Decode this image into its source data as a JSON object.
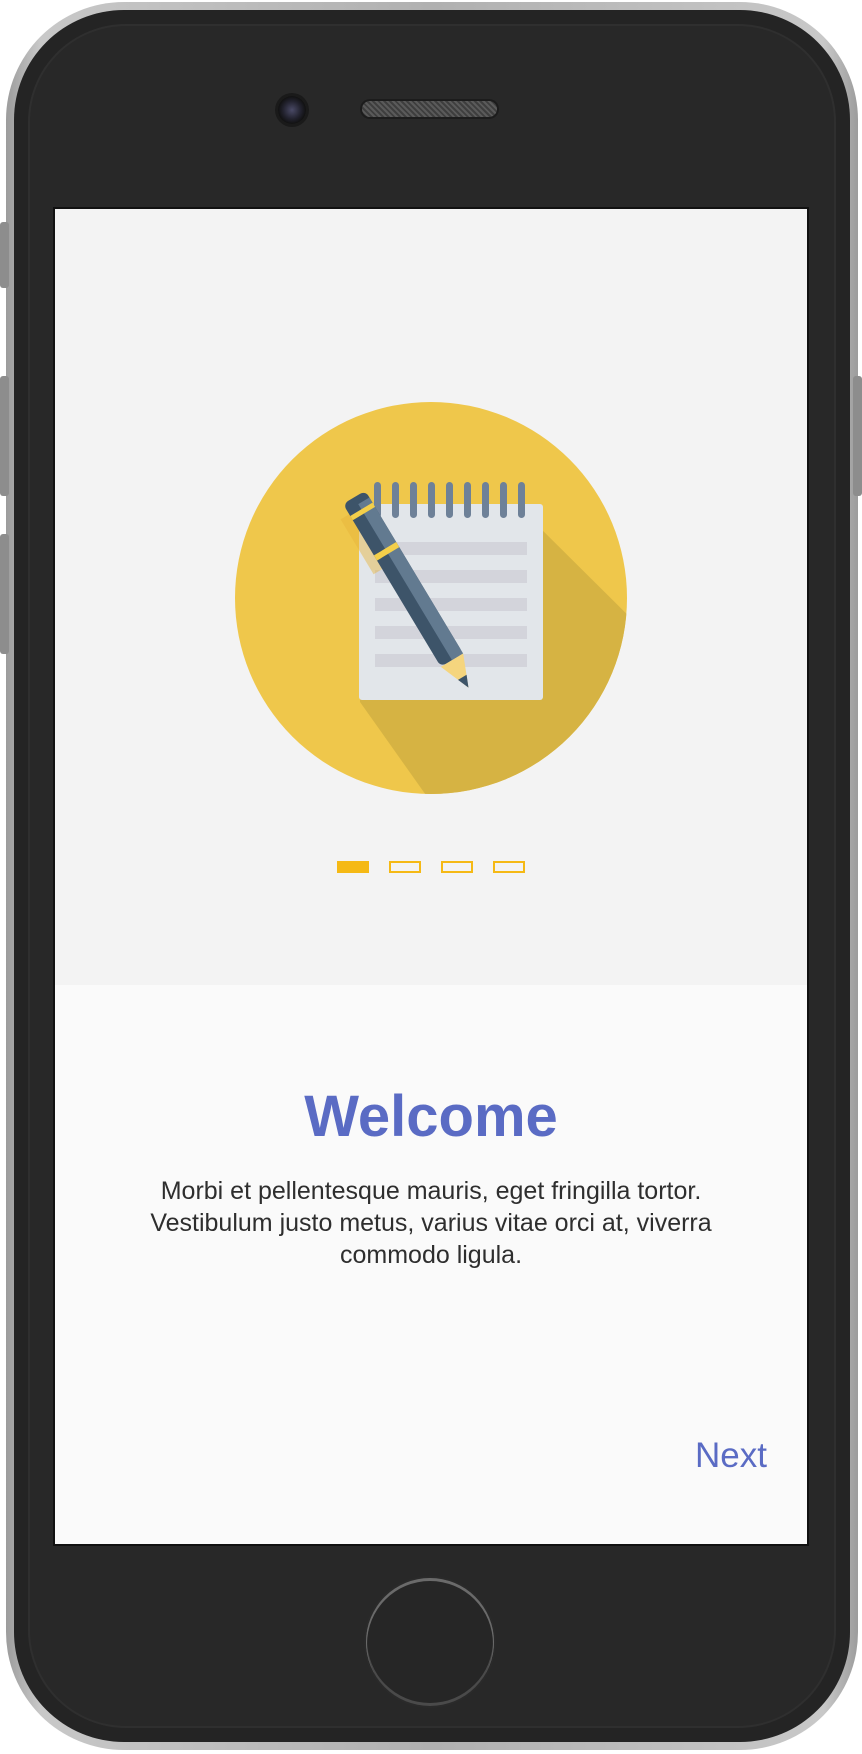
{
  "device": {
    "frame_color": "#242424",
    "bezel_color": "#b0b0b0"
  },
  "onboarding": {
    "illustration_icon": "notepad-pencil-icon",
    "pager": {
      "total": 4,
      "active_index": 0,
      "color": "#f5b915"
    },
    "title": "Welcome",
    "description": "Morbi et pellentesque mauris, eget fringilla tortor. Vestibulum justo metus, varius vitae orci at, viverra commodo ligula.",
    "next_label": "Next",
    "accent_color": "#5a6bc4"
  }
}
